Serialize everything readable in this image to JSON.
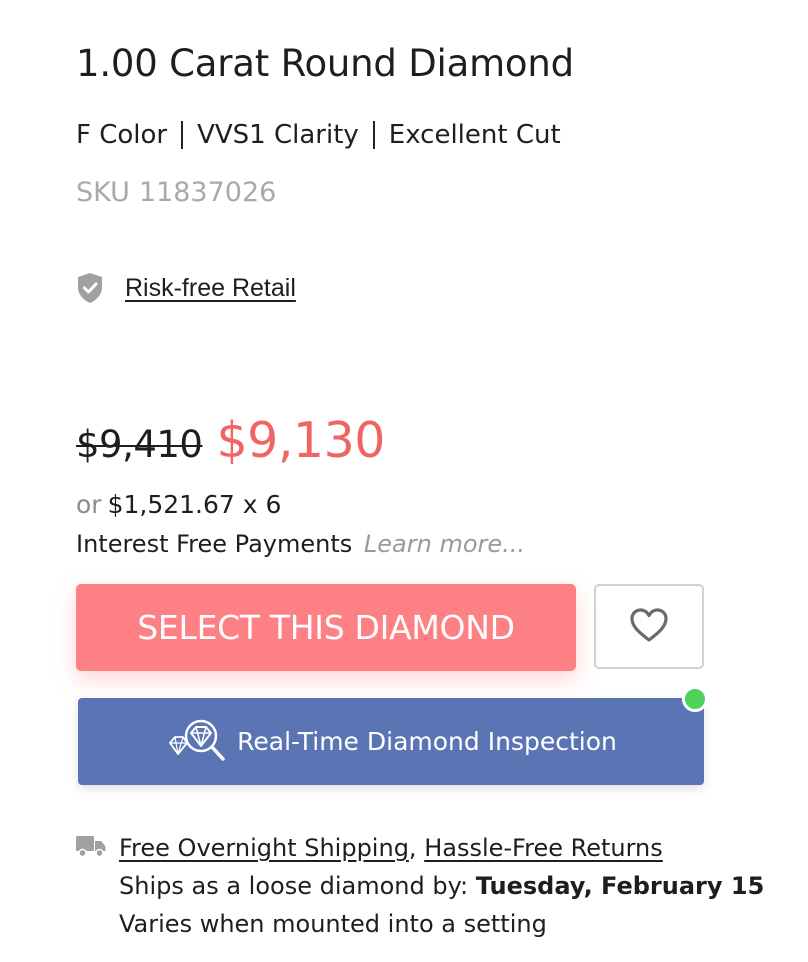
{
  "product": {
    "title": "1.00 Carat Round Diamond",
    "specs": {
      "color": "F Color",
      "clarity": "VVS1 Clarity",
      "cut": "Excellent Cut"
    },
    "sku_label": "SKU",
    "sku_value": "11837026"
  },
  "badge": {
    "icon": "shield-check-icon",
    "label": "Risk-free Retail"
  },
  "pricing": {
    "original_price": "$9,410",
    "sale_price": "$9,130",
    "installment_prefix": "or",
    "installment_amount": "$1,521.67 x 6",
    "interest_text": "Interest Free Payments",
    "learn_more": "Learn more...",
    "sale_color": "#f06563"
  },
  "actions": {
    "select_label": "SELECT THIS DIAMOND",
    "select_color": "#fd8084",
    "wishlist_icon": "heart-icon",
    "inspection_label": "Real-Time Diamond Inspection",
    "inspection_icon": "diamond-magnifier-icon",
    "inspection_color": "#5a74b4",
    "online_status_color": "#4fd25a"
  },
  "shipping": {
    "icon": "truck-icon",
    "free_shipping_link": "Free Overnight Shipping",
    "separator": ",",
    "returns_link": "Hassle-Free Returns",
    "ships_text": "Ships as a loose diamond by:",
    "ship_date": "Tuesday, February 15",
    "varies_text": "Varies when mounted into a setting"
  }
}
